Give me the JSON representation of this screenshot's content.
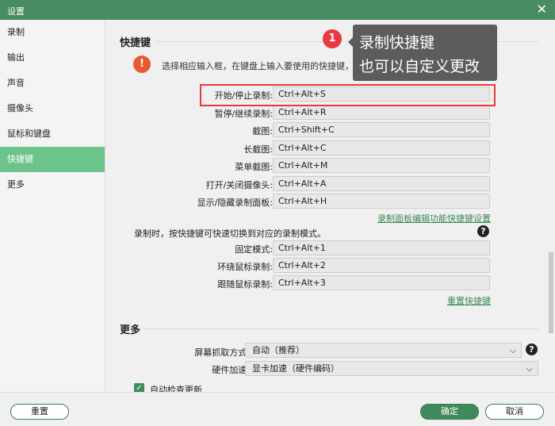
{
  "window": {
    "title": "设置",
    "close_icon": "close-icon"
  },
  "sidebar": {
    "items": [
      {
        "label": "录制"
      },
      {
        "label": "输出"
      },
      {
        "label": "声音"
      },
      {
        "label": "摄像头"
      },
      {
        "label": "鼠标和键盘"
      },
      {
        "label": "快捷键",
        "active": true
      },
      {
        "label": "更多"
      }
    ]
  },
  "shortcuts": {
    "title": "快捷键",
    "info": "选择相应输入框，在键盘上输入要使用的快捷键，我",
    "rows": [
      {
        "label": "开始/停止录制:",
        "value": "Ctrl+Alt+S"
      },
      {
        "label": "暂停/继续录制:",
        "value": "Ctrl+Alt+R"
      },
      {
        "label": "截图:",
        "value": "Ctrl+Shift+C"
      },
      {
        "label": "长截图:",
        "value": "Ctrl+Alt+C"
      },
      {
        "label": "菜单截图:",
        "value": "Ctrl+Alt+M"
      },
      {
        "label": "打开/关闭摄像头:",
        "value": "Ctrl+Alt+A"
      },
      {
        "label": "显示/隐藏录制面板:",
        "value": "Ctrl+Alt+H"
      }
    ],
    "panel_link": "录制面板编辑功能快捷键设置",
    "mode_note": "录制时，按快捷键可快速切换到对应的录制模式。",
    "mode_rows": [
      {
        "label": "固定模式:",
        "value": "Ctrl+Alt+1"
      },
      {
        "label": "环绕鼠标录制:",
        "value": "Ctrl+Alt+2"
      },
      {
        "label": "跟随鼠标录制:",
        "value": "Ctrl+Alt+3"
      }
    ],
    "reset_link": "重置快捷键"
  },
  "more": {
    "title": "更多",
    "capture_label": "屏幕抓取方式:",
    "capture_value": "自动（推荐）",
    "accel_label": "硬件加速:",
    "accel_value": "显卡加速（硬件编码）",
    "auto_update_label": "自动检查更新",
    "auto_update_checked": true
  },
  "annotation": {
    "badge": "1",
    "line1": "录制快捷键",
    "line2": "也可以自定义更改",
    "accent": "#e8393f"
  },
  "footer": {
    "reset": "重置",
    "ok": "确定",
    "cancel": "取消"
  },
  "colors": {
    "accent": "#4a8c62",
    "active": "#6cc48a"
  }
}
